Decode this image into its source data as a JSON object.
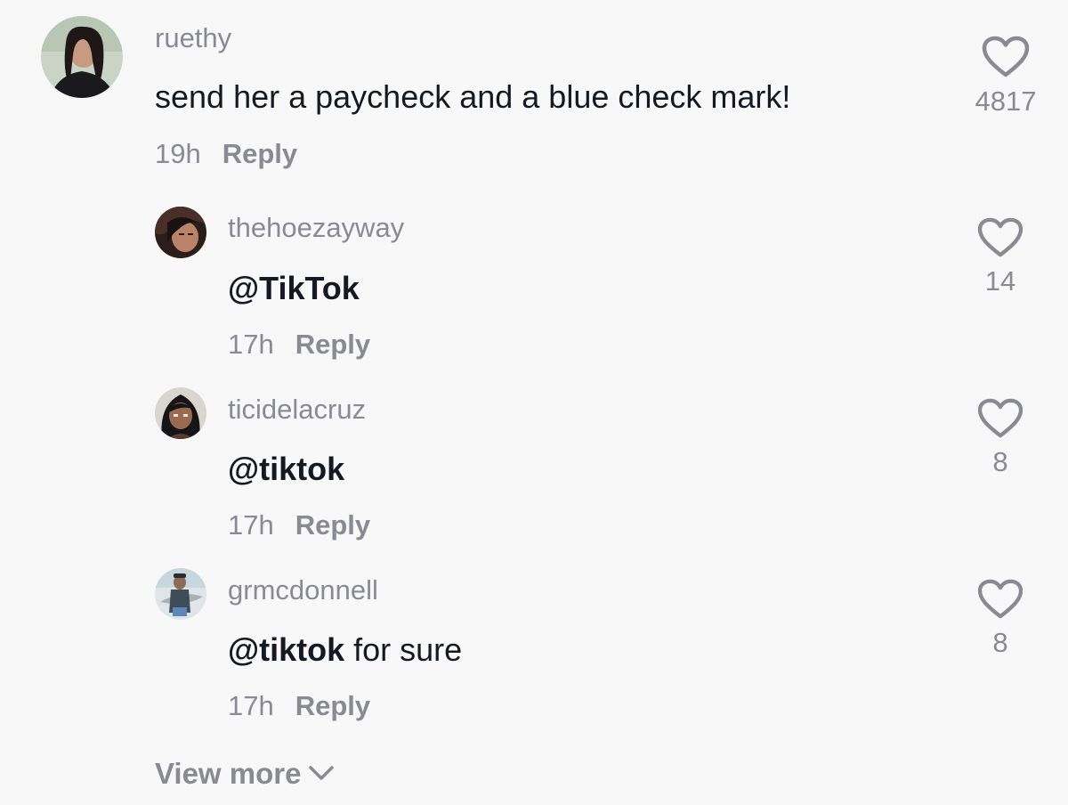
{
  "comments": [
    {
      "username": "ruethy",
      "text": "send her a paycheck and a blue check mark!",
      "time": "19h",
      "reply_label": "Reply",
      "likes": "4817"
    },
    {
      "username": "thehoezayway",
      "mention": "@TikTok",
      "rest": "",
      "time": "17h",
      "reply_label": "Reply",
      "likes": "14"
    },
    {
      "username": "ticidelacruz",
      "mention": "@tiktok",
      "rest": "",
      "time": "17h",
      "reply_label": "Reply",
      "likes": "8"
    },
    {
      "username": "grmcdonnell",
      "mention": "@tiktok",
      "rest": " for sure",
      "time": "17h",
      "reply_label": "Reply",
      "likes": "8"
    }
  ],
  "view_more_label": "View more",
  "icons": {
    "like": "heart-outline-icon",
    "expand": "chevron-down-icon"
  },
  "colors": {
    "background": "#f8f8f8",
    "primary_text": "#161823",
    "secondary_text": "#8a8b91"
  }
}
